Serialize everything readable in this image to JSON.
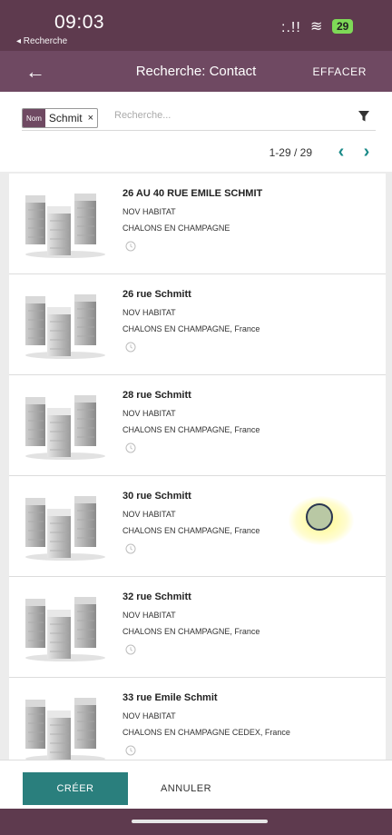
{
  "status_bar": {
    "time": "09:03",
    "back_app": "◂ Recherche",
    "battery": "29",
    "signal_icon": "signal-icon",
    "wifi_icon": "wifi-icon"
  },
  "nav": {
    "back_icon": "arrow-left-icon",
    "title": "Recherche: Contact",
    "clear": "EFFACER"
  },
  "search": {
    "facet_tag": "Nom",
    "facet_value": "Schmit",
    "facet_remove": "×",
    "placeholder": "Recherche...",
    "filter_icon": "filter-icon"
  },
  "pager": {
    "value": "1-29 / 29",
    "prev": "‹",
    "next": "›"
  },
  "records": [
    {
      "title": "26 AU 40 RUE EMILE SCHMIT",
      "company": "NOV HABITAT",
      "city": "CHALONS EN CHAMPAGNE"
    },
    {
      "title": "26 rue Schmitt",
      "company": "NOV HABITAT",
      "city": "CHALONS EN CHAMPAGNE, France"
    },
    {
      "title": "28 rue Schmitt",
      "company": "NOV HABITAT",
      "city": "CHALONS EN CHAMPAGNE, France"
    },
    {
      "title": "30 rue Schmitt",
      "company": "NOV HABITAT",
      "city": "CHALONS EN CHAMPAGNE, France"
    },
    {
      "title": "32 rue Schmitt",
      "company": "NOV HABITAT",
      "city": "CHALONS EN CHAMPAGNE, France"
    },
    {
      "title": "33 rue Emile Schmit",
      "company": "NOV HABITAT",
      "city": "CHALONS EN CHAMPAGNE CEDEX, France"
    }
  ],
  "footer": {
    "create": "CRÉER",
    "cancel": "ANNULER"
  },
  "colors": {
    "brand": "#6f4962",
    "accent": "#2a7f7d"
  }
}
